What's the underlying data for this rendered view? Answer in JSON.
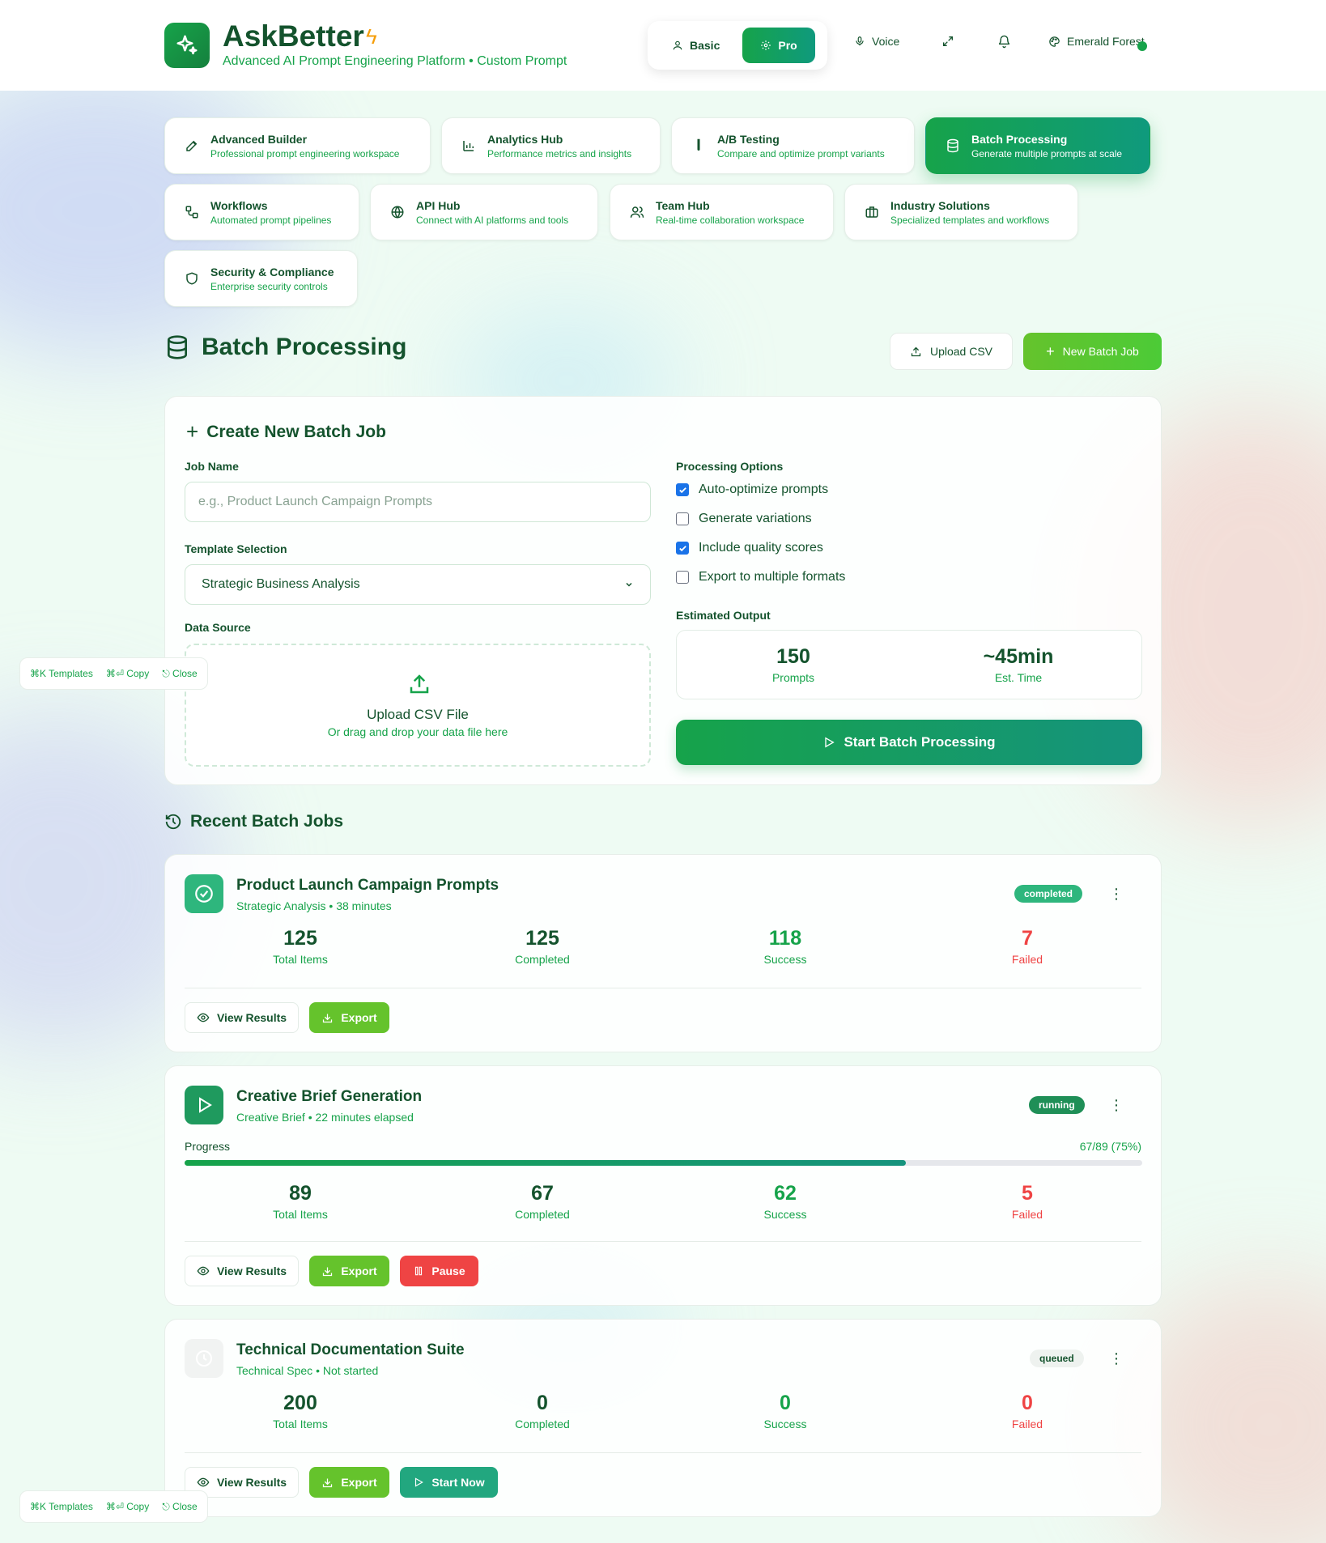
{
  "header": {
    "brand": "AskBetter",
    "tagline": "Advanced AI Prompt Engineering Platform • Custom Prompt",
    "mode_basic": "Basic",
    "mode_pro": "Pro",
    "voice": "Voice",
    "theme": "Emerald Forest"
  },
  "nav": [
    {
      "title": "Advanced Builder",
      "desc": "Professional prompt engineering workspace",
      "icon": "pencil-icon"
    },
    {
      "title": "Analytics Hub",
      "desc": "Performance metrics and insights",
      "icon": "bar-chart-icon"
    },
    {
      "title": "A/B Testing",
      "desc": "Compare and optimize prompt variants",
      "icon": "test-tube-icon"
    },
    {
      "title": "Batch Processing",
      "desc": "Generate multiple prompts at scale",
      "icon": "database-icon",
      "active": true
    },
    {
      "title": "Workflows",
      "desc": "Automated prompt pipelines",
      "icon": "workflow-icon"
    },
    {
      "title": "API Hub",
      "desc": "Connect with AI platforms and tools",
      "icon": "globe-icon"
    },
    {
      "title": "Team Hub",
      "desc": "Real-time collaboration workspace",
      "icon": "users-icon"
    },
    {
      "title": "Industry Solutions",
      "desc": "Specialized templates and workflows",
      "icon": "briefcase-icon"
    },
    {
      "title": "Security & Compliance",
      "desc": "Enterprise security controls",
      "icon": "shield-icon"
    }
  ],
  "page": {
    "title": "Batch Processing",
    "upload_csv": "Upload CSV",
    "new_batch_job": "New Batch Job"
  },
  "create": {
    "title": "Create New Batch Job",
    "job_name_label": "Job Name",
    "job_name_placeholder": "e.g., Product Launch Campaign Prompts",
    "template_label": "Template Selection",
    "template_value": "Strategic Business Analysis",
    "data_source_label": "Data Source",
    "upload_title": "Upload CSV File",
    "upload_hint": "Or drag and drop your data file here",
    "options_label": "Processing Options",
    "options": [
      {
        "label": "Auto-optimize prompts",
        "checked": true
      },
      {
        "label": "Generate variations",
        "checked": false
      },
      {
        "label": "Include quality scores",
        "checked": true
      },
      {
        "label": "Export to multiple formats",
        "checked": false
      }
    ],
    "estimated_label": "Estimated Output",
    "est_prompts_value": "150",
    "est_prompts_label": "Prompts",
    "est_time_value": "~45min",
    "est_time_label": "Est. Time",
    "start_button": "Start Batch Processing"
  },
  "recent": {
    "title": "Recent Batch Jobs",
    "jobs": [
      {
        "name": "Product Launch Campaign Prompts",
        "template": "Strategic Analysis",
        "time": "38 minutes",
        "status": "completed",
        "total": "125",
        "completed": "125",
        "success": "118",
        "failed": "7"
      },
      {
        "name": "Creative Brief Generation",
        "template": "Creative Brief",
        "time": "22 minutes elapsed",
        "status": "running",
        "progress_label": "Progress",
        "progress_text": "67/89 (75%)",
        "progress_fraction": 0.753,
        "total": "89",
        "completed": "67",
        "success": "62",
        "failed": "5"
      },
      {
        "name": "Technical Documentation Suite",
        "template": "Technical Spec",
        "time": "Not started",
        "status": "queued",
        "total": "200",
        "completed": "0",
        "success": "0",
        "failed": "0"
      }
    ],
    "labels": {
      "total": "Total Items",
      "completed": "Completed",
      "success": "Success",
      "failed": "Failed",
      "view_results": "View Results",
      "export": "Export",
      "pause": "Pause",
      "start_now": "Start Now",
      "separator": "•"
    }
  },
  "shortcuts": {
    "templates": "⌘K Templates",
    "copy": "⌘⏎ Copy",
    "close": "⎋ Close"
  },
  "colors": {
    "primary": "#16a34a",
    "dark_green": "#14532d",
    "lime": "#65c32c",
    "danger": "#ef4444",
    "teal": "#22a77f"
  }
}
